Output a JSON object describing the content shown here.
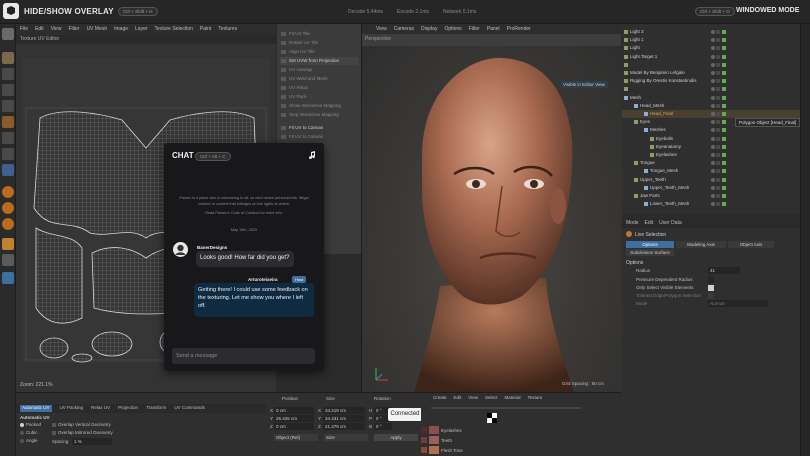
{
  "topbar": {
    "title": "HIDE/SHOW OVERLAY",
    "title_hotkey": "Ctrl + Shift + H",
    "decode": "Decode 5.44ms",
    "encode": "Encode 2.1ms",
    "network": "Network 0.1ms",
    "mode_hotkey": "Ctrl + Shift + O",
    "mode": "WINDOWED MODE"
  },
  "uv_editor": {
    "menu": [
      "File",
      "Edit",
      "View",
      "Filter",
      "UV Mesh",
      "Image",
      "Layer",
      "Texture Selection",
      "Paint",
      "Textures"
    ],
    "subtitle": "Texture UV Editor",
    "axis_top": "0.1",
    "axis_left_top": "0.1",
    "axis_bottom": "0.0",
    "axis_right": "1.1",
    "zoom": "Zoom: 221.1%"
  },
  "command_panel": {
    "items": [
      "Fit UV Tile",
      "Rotate UV Tile",
      "Align UV Tile",
      "Set UVW from Projection",
      "UV Unwrap",
      "UV Weld and Mesh",
      "UV Relax",
      "UV Pack",
      "Show Interactive Mapping",
      "Stop Interactive Mapping",
      "Fit UV to Canvas",
      "Fit UV to Canvas",
      "Shrink UV",
      "Scale UV"
    ]
  },
  "viewport": {
    "menu": [
      "View",
      "Cameras",
      "Display",
      "Options",
      "Filter",
      "Panel",
      "ProRender"
    ],
    "label": "Perspective",
    "tag": "Visible in Editor View",
    "grid": "Grid Spacing : 50 cm"
  },
  "object_manager": {
    "items": [
      {
        "name": "Light 3",
        "indent": 8,
        "sel": false
      },
      {
        "name": "Light 1",
        "indent": 8,
        "sel": false
      },
      {
        "name": "Light",
        "indent": 8,
        "sel": false
      },
      {
        "name": "Light.Target.1",
        "indent": 8,
        "sel": false
      },
      {
        "name": "",
        "indent": 8,
        "sel": false
      },
      {
        "name": "Model By Benjamin Lefgale",
        "indent": 8,
        "sel": false
      },
      {
        "name": "Rigging By Orestis Konstantinidis",
        "indent": 8,
        "sel": false
      },
      {
        "name": "",
        "indent": 8,
        "sel": false
      },
      {
        "name": "Mesh",
        "indent": 8,
        "sel": false
      },
      {
        "name": "Head_Mesh",
        "indent": 18,
        "sel": false
      },
      {
        "name": "Head_Final",
        "indent": 28,
        "sel": true
      },
      {
        "name": "Eyes",
        "indent": 18,
        "sel": false
      },
      {
        "name": "Meshes",
        "indent": 28,
        "sel": false
      },
      {
        "name": "Eyeballs",
        "indent": 34,
        "sel": false
      },
      {
        "name": "Eyeanatomy",
        "indent": 34,
        "sel": false
      },
      {
        "name": "Eyelashes",
        "indent": 34,
        "sel": false
      },
      {
        "name": "Tongue",
        "indent": 18,
        "sel": false
      },
      {
        "name": "Tongue_Mesh",
        "indent": 28,
        "sel": false
      },
      {
        "name": "Upper_Teeth",
        "indent": 18,
        "sel": false
      },
      {
        "name": "Upper_Teeth_Mesh",
        "indent": 28,
        "sel": false
      },
      {
        "name": "Jaw Parts",
        "indent": 18,
        "sel": false
      },
      {
        "name": "Lower_Teeth_Mesh",
        "indent": 28,
        "sel": false
      }
    ],
    "tooltip": "Polygon Object [Head_Final]"
  },
  "attributes": {
    "menu": [
      "Mode",
      "Edit",
      "User Data"
    ],
    "title": "Live Selection",
    "tabs": [
      "Options",
      "Modeling Axis",
      "Object Axis"
    ],
    "subtab": "Subdivision Surface",
    "section": "Options",
    "rows": [
      {
        "label": "Radius",
        "value": "41"
      },
      {
        "label": "Pressure Dependent Radius",
        "value": ""
      },
      {
        "label": "Only Select Visible Elements",
        "value": ""
      },
      {
        "label": "Tolerant Edge/Polygon Selection",
        "value": ""
      },
      {
        "label": "Mode",
        "value": "Normal"
      }
    ]
  },
  "chat": {
    "title": "CHAT",
    "hotkey": "Ctrl + Alt + C",
    "info": "Parsec is a place who is welcoming to all, so don't share personal info, illegal content or content that infringes on the rights of others.",
    "info2": "Read Parsec's Code of Conduct for more info.",
    "date": "May 15th, 2020",
    "msg1_user": "BanerDesigns",
    "msg1_text": "Looks good! How far did you get?",
    "msg2_user": "Arturoteixeira",
    "msg2_badge": "Host",
    "msg2_text": "Getting there! I could use some feedback on the texturing. Let me show you where I left off.",
    "input_placeholder": "Send a message"
  },
  "bottom_left": {
    "tabs": [
      "Automatic UV",
      "UV Packing",
      "Relax UV",
      "Projection",
      "Transform",
      "UV Commands"
    ],
    "section": "Automatic UV",
    "options": [
      "Packed",
      "Cubic",
      "Angle"
    ],
    "checks": [
      "Overlap Vertical Geometry",
      "Overlap Mirrored Geometry"
    ],
    "spacing_label": "Spacing",
    "spacing_value": "1 %"
  },
  "coords": {
    "headers": [
      "Position",
      "Size",
      "Rotation"
    ],
    "axes": [
      "X",
      "Y",
      "Z"
    ],
    "pos": [
      "0 cm",
      "25.426 cm",
      "0 cm"
    ],
    "size": [
      "34.219 cm",
      "34.431 cm",
      "21.379 cm"
    ],
    "rot_labels": [
      "H",
      "P",
      "B"
    ],
    "rot": [
      "0 °",
      "0 °",
      "0 °"
    ],
    "dropdown1": "Object (Rel)",
    "dropdown2": "Size",
    "apply": "Apply",
    "connected": "Connected"
  },
  "materials": {
    "menu": [
      "Create",
      "Edit",
      "View",
      "Select",
      "Material",
      "Texture"
    ],
    "items": [
      "Eyelashes",
      "Teeth",
      "Flesh Tone"
    ]
  }
}
